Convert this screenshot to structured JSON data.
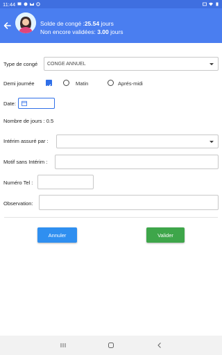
{
  "status_bar": {
    "time": "11:44"
  },
  "header": {
    "solde_label": "Solde de congé :",
    "solde_value": "25.54",
    "solde_unit": " jours",
    "non_valid_label": "Non encore validées: ",
    "non_valid_value": "3.00",
    "non_valid_unit": " jours"
  },
  "form": {
    "type_conge": {
      "label": "Type de congé",
      "value": "CONGE ANNUEL"
    },
    "demi_journee": {
      "label": "Demi journée",
      "checked": true,
      "options": [
        "Matin",
        "Aprés-midi"
      ]
    },
    "date": {
      "label": "Date:"
    },
    "nombre_jours": {
      "label": "Nombre de jours :",
      "value": "0.5"
    },
    "interim": {
      "label": "Intérim assuré par :",
      "value": ""
    },
    "motif": {
      "label": "Motif sans Intérim :",
      "value": ""
    },
    "numero_tel": {
      "label": "Numéro Tel :",
      "value": ""
    },
    "observation": {
      "label": "Observation:",
      "value": ""
    }
  },
  "buttons": {
    "annuler": "Annuler",
    "valider": "Valider"
  },
  "colors": {
    "appbar": "#4a7ef0",
    "btn_annuler": "#2f8ff0",
    "btn_valider": "#3ea64a"
  }
}
